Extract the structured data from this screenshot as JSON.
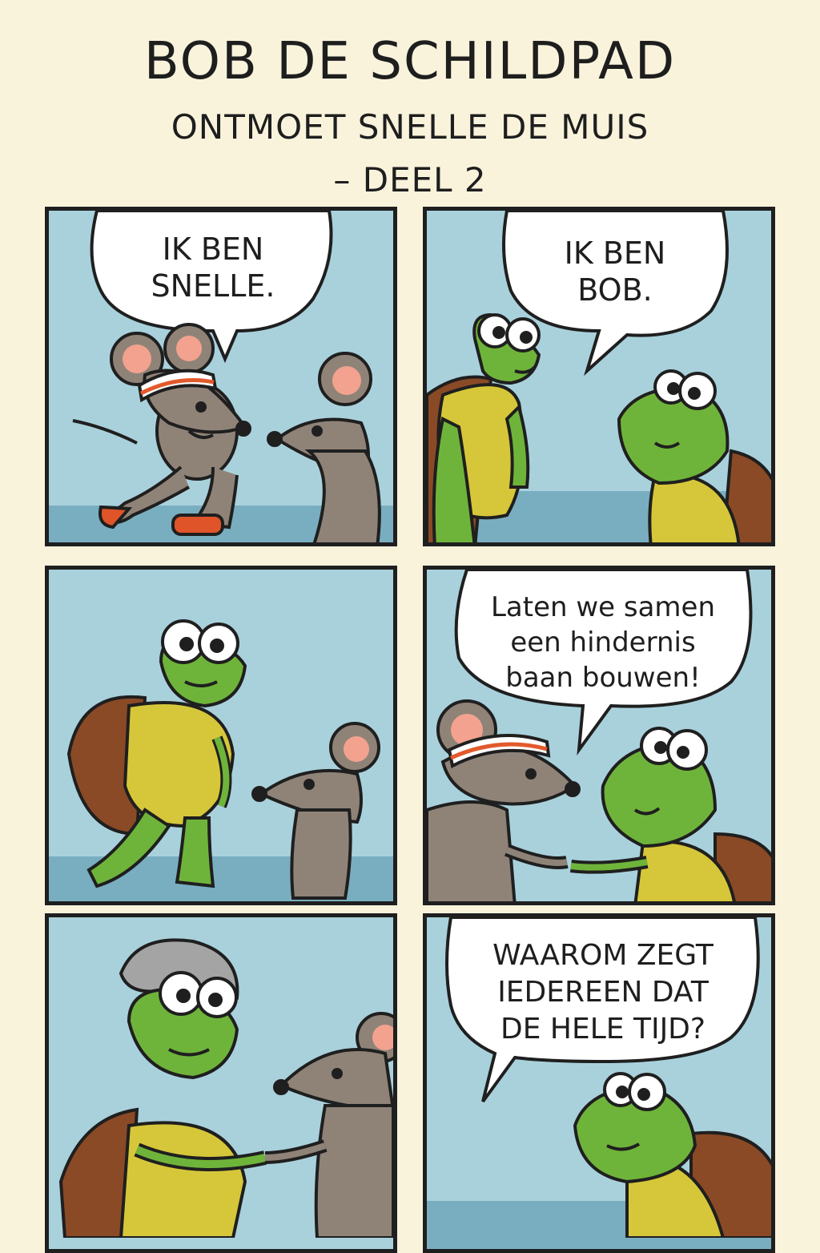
{
  "comic": {
    "title": "BOB DE SCHILDPAD",
    "subtitle": "ONTMOET SNELLE DE MUIS",
    "part": "– DEEL 2"
  },
  "panels": [
    {
      "speech": [
        "IK BEN",
        "SNELLE."
      ]
    },
    {
      "speech": [
        "IK BEN",
        "BOB."
      ]
    },
    {
      "speech": []
    },
    {
      "speech": [
        "Laten we samen",
        "een hindernis",
        "baan bouwen!"
      ]
    },
    {
      "speech": []
    },
    {
      "speech": [
        "WAAROM ZEGT",
        "IEDEREEN DAT",
        "DE HELE TIJD?"
      ]
    }
  ],
  "colors": {
    "page": "#faf3dc",
    "panel_sky": "#a9d1dc",
    "panel_floor": "#79aec0",
    "outline": "#1f1f1f",
    "turtle_skin": "#6fb43a",
    "turtle_belly": "#d6c73a",
    "turtle_shell": "#8a4a26",
    "mouse_fur": "#8f8378",
    "mouse_ear": "#f2a28e",
    "headband": "#e25a2c",
    "sneaker": "#e0542a"
  },
  "icons": [
    "speech-bubble",
    "mouse-character",
    "turtle-character",
    "headband",
    "sneakers"
  ]
}
